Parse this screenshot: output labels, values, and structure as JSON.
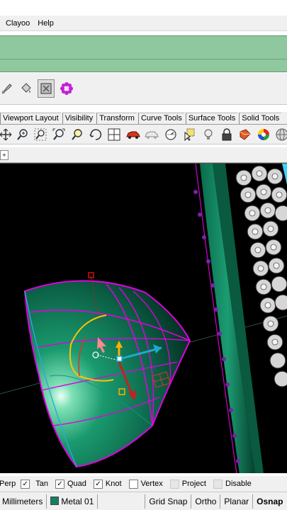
{
  "menu": {
    "items": [
      "Clayoo",
      "Help"
    ]
  },
  "ribbon_tabs": [
    "Viewport Layout",
    "Visibility",
    "Transform",
    "Curve Tools",
    "Surface Tools",
    "Solid Tools"
  ],
  "toolbar_top": {
    "icons": [
      "paint-brush-icon",
      "paint-bucket-icon",
      "render-window-icon",
      "gear-flower-icon"
    ]
  },
  "toolbar_main": {
    "icons": [
      "pan-arrows-icon",
      "zoom-icon",
      "zoom-window-icon",
      "zoom-extents-icon",
      "zoom-selected-icon",
      "rotate-view-icon",
      "four-viewports-icon",
      "car-icon",
      "wireframe-car-icon",
      "gauge-icon",
      "select-icon",
      "light-bulb-icon",
      "lock-icon",
      "material-icon",
      "color-wheel-icon",
      "sphere-icon"
    ]
  },
  "osnap": {
    "items": [
      {
        "label": "Perp",
        "checked": true,
        "enabled": true
      },
      {
        "label": "Tan",
        "checked": true,
        "enabled": true
      },
      {
        "label": "Quad",
        "checked": true,
        "enabled": true
      },
      {
        "label": "Knot",
        "checked": true,
        "enabled": true
      },
      {
        "label": "Vertex",
        "checked": false,
        "enabled": true
      },
      {
        "label": "Project",
        "checked": false,
        "enabled": false
      },
      {
        "label": "Disable",
        "checked": false,
        "enabled": false
      }
    ]
  },
  "status": {
    "units": "Millimeters",
    "layer": "Metal 01",
    "layer_color": "#138063",
    "grid_snap": "Grid Snap",
    "ortho": "Ortho",
    "planar": "Planar",
    "osnap": "Osnap"
  },
  "colors": {
    "command_area": "#8fc79e",
    "viewport_bg": "#000000",
    "surface_green": "#0f7a5a",
    "selection_magenta": "#e000e0"
  }
}
